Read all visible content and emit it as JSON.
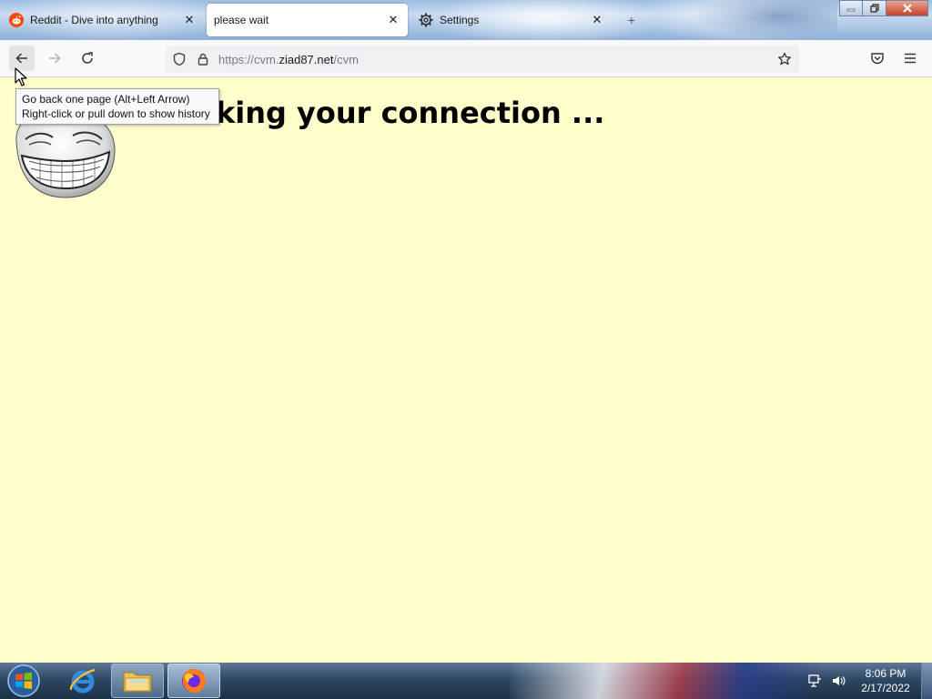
{
  "tabs": [
    {
      "label": "Reddit - Dive into anything",
      "icon": "reddit-icon",
      "active": false
    },
    {
      "label": "please wait",
      "icon": "",
      "active": true
    },
    {
      "label": "Settings",
      "icon": "gear-icon",
      "active": false
    }
  ],
  "navbar": {
    "url_prefix": "https://cvm.",
    "url_domain": "ziad87.net",
    "url_path": "/cvm"
  },
  "tooltip": {
    "line1": "Go back one page (Alt+Left Arrow)",
    "line2": "Right-click or pull down to show history"
  },
  "page": {
    "heading": "Checking your connection ...",
    "background_color": "#ffffcc"
  },
  "taskbar": {
    "time": "8:06 PM",
    "date": "2/17/2022"
  },
  "colors": {
    "reddit": "#ff4500",
    "active_tab": "#ffffff"
  }
}
